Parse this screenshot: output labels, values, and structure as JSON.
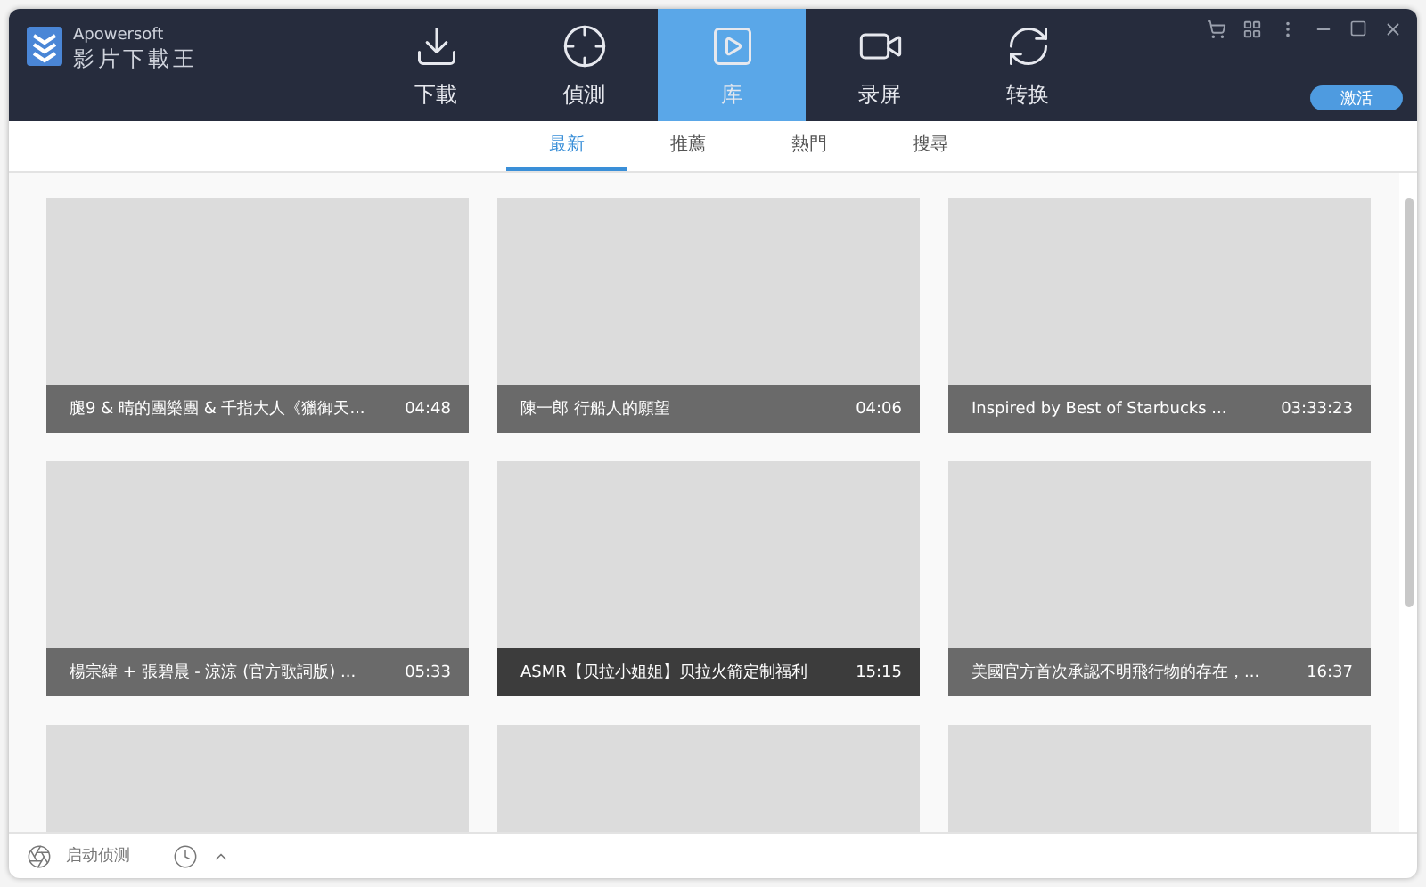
{
  "app": {
    "brand": "Apowersoft",
    "title": "影片下載王"
  },
  "nav": [
    {
      "label": "下載",
      "selected": false
    },
    {
      "label": "偵測",
      "selected": false
    },
    {
      "label": "库",
      "selected": true
    },
    {
      "label": "录屏",
      "selected": false
    },
    {
      "label": "转换",
      "selected": false
    }
  ],
  "activate_button": "激活",
  "subtabs": [
    {
      "label": "最新",
      "selected": true
    },
    {
      "label": "推薦",
      "selected": false
    },
    {
      "label": "熱門",
      "selected": false
    },
    {
      "label": "搜尋",
      "selected": false
    }
  ],
  "videos": [
    {
      "kind": "video",
      "title": "腿9 & 晴的團樂團 & 千指大人《獵御天...",
      "duration": "04:48",
      "hovered": false
    },
    {
      "kind": "video",
      "title": "陳一郎 行船人的願望",
      "duration": "04:06",
      "hovered": false
    },
    {
      "kind": "video",
      "title": "Inspired by Best of Starbucks ...",
      "duration": "03:33:23",
      "hovered": false
    },
    {
      "kind": "video",
      "title": "楊宗緯 + 張碧晨 - 涼涼 (官方歌詞版) ...",
      "duration": "05:33",
      "hovered": false
    },
    {
      "kind": "video",
      "title": "ASMR【贝拉小姐姐】贝拉火箭定制福利",
      "duration": "15:15",
      "hovered": true
    },
    {
      "kind": "video",
      "title": "美國官方首次承認不明飛行物的存在，...",
      "duration": "16:37",
      "hovered": false
    },
    {
      "kind": "partial"
    },
    {
      "kind": "partial"
    },
    {
      "kind": "partial"
    }
  ],
  "status_bar": {
    "auto_detect": "启动侦测"
  }
}
